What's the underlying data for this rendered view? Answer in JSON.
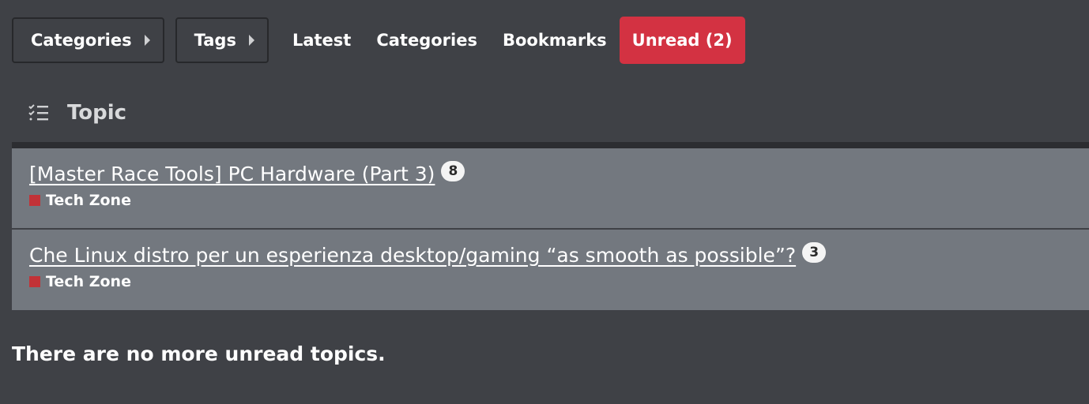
{
  "nav": {
    "dropdowns": [
      {
        "label": "Categories"
      },
      {
        "label": "Tags"
      }
    ],
    "links": [
      {
        "label": "Latest",
        "active": false
      },
      {
        "label": "Categories",
        "active": false
      },
      {
        "label": "Bookmarks",
        "active": false
      },
      {
        "label": "Unread (2)",
        "active": true
      }
    ],
    "active_color": "#d33242"
  },
  "list_header": {
    "icon": "list-check-icon",
    "title": "Topic"
  },
  "topics": [
    {
      "title": "[Master Race Tools] PC Hardware (Part 3)",
      "unread_count": "8",
      "category": "Tech Zone",
      "category_color": "#c23237"
    },
    {
      "title": "Che Linux distro per un esperienza desktop/gaming “as smooth as possible”?",
      "unread_count": "3",
      "category": "Tech Zone",
      "category_color": "#c23237"
    }
  ],
  "footer_message": "There are no more unread topics."
}
